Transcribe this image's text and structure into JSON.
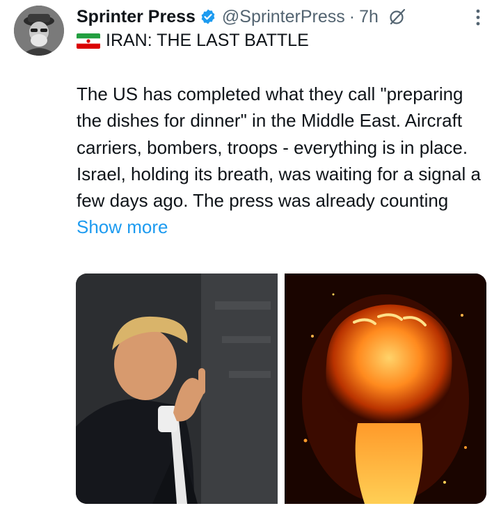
{
  "tweet": {
    "author": {
      "display_name": "Sprinter Press",
      "handle": "@SprinterPress",
      "verified": true,
      "avatar_icon": "avatar-photo"
    },
    "time_separator": "·",
    "time": "7h",
    "header_icons": [
      "verified-badge-icon",
      "grok-icon",
      "more-options-icon"
    ],
    "headline": {
      "flag_icon": "iran-flag-icon",
      "text": "IRAN: THE LAST BATTLE"
    },
    "body": "The US has completed what they call \"preparing the dishes for dinner\" in the Middle East. Aircraft carriers, bombers, troops - everything is in place. Israel, holding its breath, was waiting for a signal a few days ago. The press was already counting ",
    "show_more_label": "Show more",
    "media": [
      {
        "kind": "photo",
        "description_icon": "person-gesture-photo"
      },
      {
        "kind": "photo",
        "description_icon": "fiery-fist-photo"
      }
    ],
    "colors": {
      "text": "#0f1419",
      "secondary": "#536471",
      "link": "#1d9bf0",
      "verified": "#1d9bf0"
    }
  }
}
